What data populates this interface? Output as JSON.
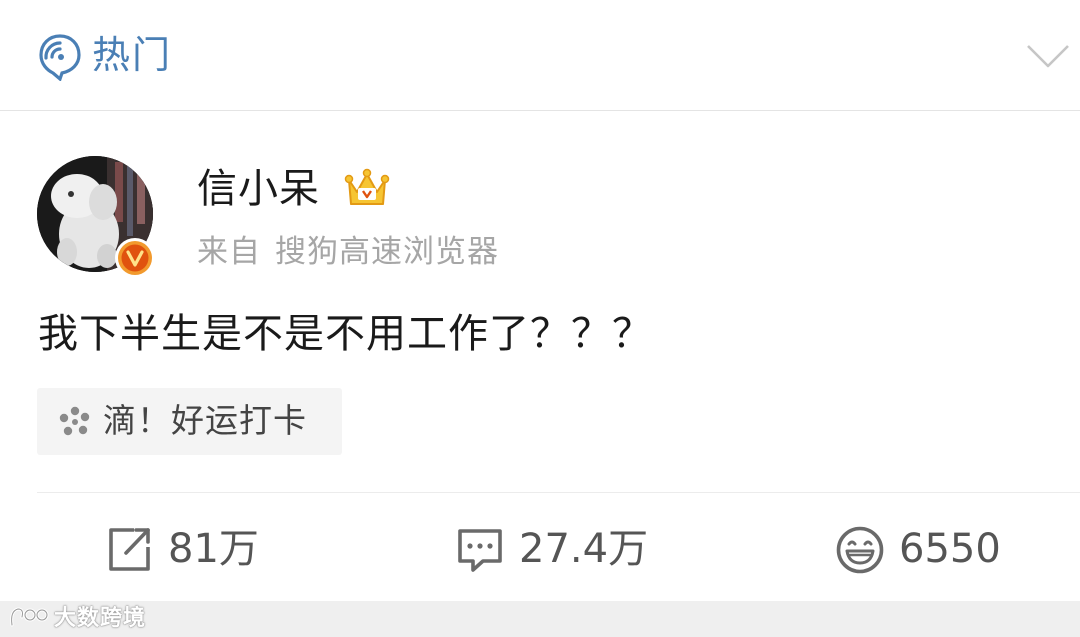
{
  "header": {
    "title": "热门",
    "icon": "hot-topic-icon",
    "collapse_icon": "chevron-down-icon",
    "accent_color": "#4a7fb5"
  },
  "post": {
    "author": {
      "name": "信小呆",
      "avatar": "avatar-stuffed-toy-image",
      "verified_badge": "orange-v-badge",
      "member_badge": "crown-icon"
    },
    "source_prefix": "来自",
    "source_name": "搜狗高速浏览器",
    "text": "我下半生是不是不用工作了？？？",
    "topic": {
      "icon": "lucky-dots-icon",
      "label": "滴！好运打卡"
    }
  },
  "actions": {
    "repost": {
      "icon": "repost-icon",
      "count": "81万"
    },
    "comment": {
      "icon": "comment-icon",
      "count": "27.4万"
    },
    "like": {
      "icon": "smile-icon",
      "count": "6550"
    }
  },
  "watermark": {
    "text": "大数跨境"
  }
}
